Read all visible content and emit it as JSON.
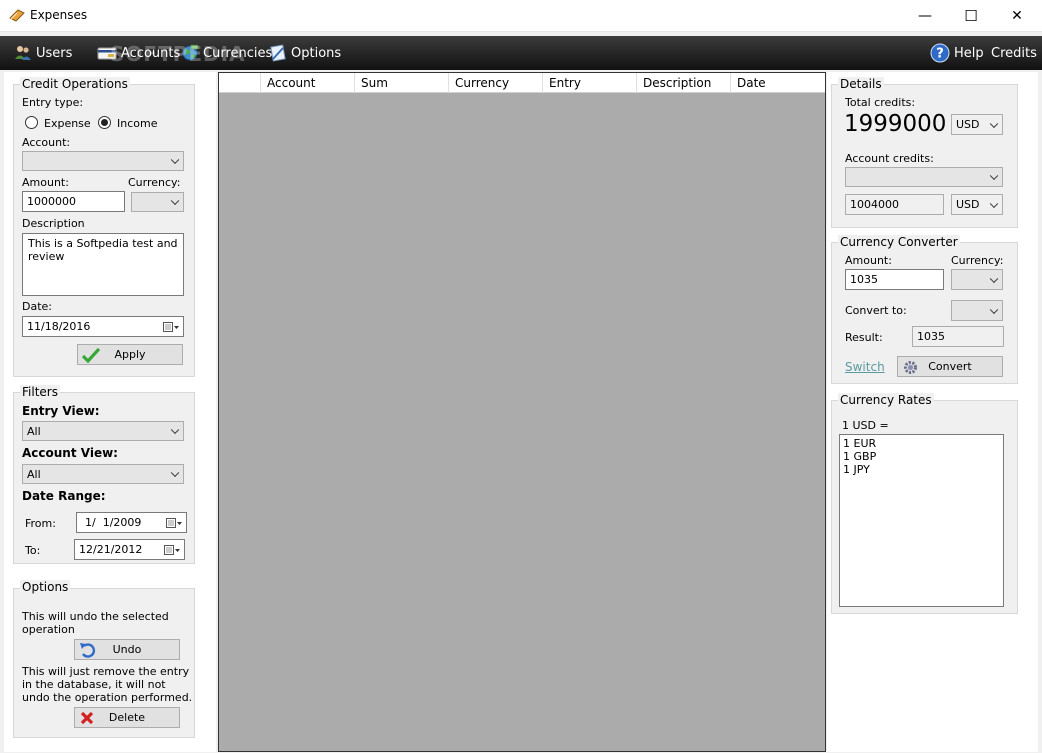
{
  "window": {
    "title": "Expenses",
    "min": "—",
    "max": "☐",
    "close": "✕"
  },
  "toolbar": {
    "items": [
      {
        "label": "Users",
        "icon": "users-icon"
      },
      {
        "label": "Accounts",
        "icon": "credit-card-icon"
      },
      {
        "label": "Currencies",
        "icon": "globe-icon"
      },
      {
        "label": "Options",
        "icon": "options-icon"
      }
    ],
    "help": "Help",
    "credits": "Credits",
    "watermark": "SOFTPEDIA"
  },
  "credit_ops": {
    "title": "Credit Operations",
    "entry_type_label": "Entry type:",
    "expense_label": "Expense",
    "income_label": "Income",
    "selected": "Income",
    "account_label": "Account:",
    "account_value": "",
    "amount_label": "Amount:",
    "amount_value": "1000000",
    "currency_label": "Currency:",
    "currency_value": "",
    "description_label": "Description",
    "description_value": "This is a Softpedia test and review",
    "date_label": "Date:",
    "date_value": "11/18/2016",
    "apply_label": "Apply"
  },
  "filters": {
    "title": "Filters",
    "entry_view_label": "Entry View:",
    "entry_view_value": "All",
    "account_view_label": "Account View:",
    "account_view_value": "All",
    "date_range_label": "Date Range:",
    "from_label": "From:",
    "from_value": "1/  1/2009",
    "to_label": "To:",
    "to_value": "12/21/2012"
  },
  "options": {
    "title": "Options",
    "undo_text": "This will undo the selected operation",
    "undo_label": "Undo",
    "delete_text": "This will just remove the entry in the database, it will not undo the operation performed.",
    "delete_label": "Delete"
  },
  "grid": {
    "columns": [
      "",
      "Account",
      "Sum",
      "Currency",
      "Entry",
      "Description",
      "Date"
    ]
  },
  "details": {
    "title": "Details",
    "total_credits_label": "Total credits:",
    "total_credits_value": "1999000",
    "total_currency": "USD",
    "account_credits_label": "Account credits:",
    "account_value": "",
    "account_credits_value": "1004000",
    "account_currency": "USD"
  },
  "converter": {
    "title": "Currency Converter",
    "amount_label": "Amount:",
    "amount_value": "1035",
    "currency_label": "Currency:",
    "currency_value": "",
    "convert_to_label": "Convert to:",
    "convert_to_value": "",
    "result_label": "Result:",
    "result_value": "1035",
    "switch_label": "Switch",
    "convert_label": "Convert"
  },
  "rates": {
    "title": "Currency Rates",
    "base": "1 USD =",
    "items": [
      "1 EUR",
      "1 GBP",
      "1 JPY"
    ]
  }
}
